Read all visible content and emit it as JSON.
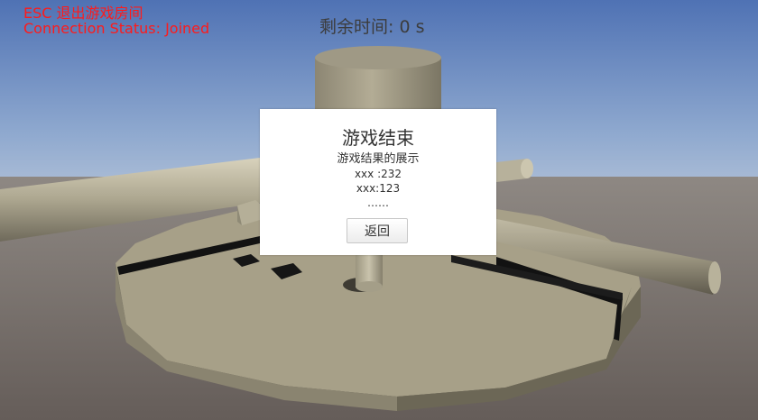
{
  "hud": {
    "esc_hint": "ESC 退出游戏房间",
    "connection_status": "Connection Status: Joined",
    "text_color": "#ff1a1a"
  },
  "timer": {
    "label": "剩余时间:",
    "value": "0 s"
  },
  "dialog": {
    "title": "游戏结束",
    "subtitle": "游戏结果的展示",
    "results": [
      "xxx :232",
      "xxx:123",
      "……"
    ],
    "back_button_label": "返回"
  }
}
